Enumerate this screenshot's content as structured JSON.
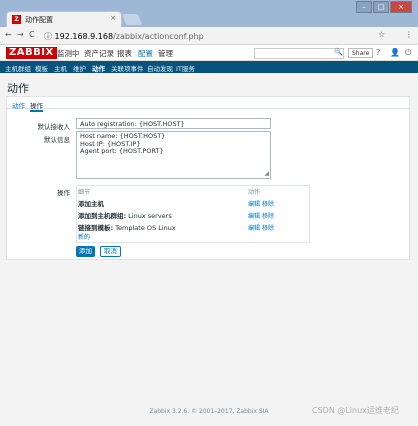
{
  "browser": {
    "tab_icon": "Z",
    "tab_title": "动作配置",
    "tab_close": "×",
    "url_host": "192.168.9.168",
    "url_path": "/zabbix/actionconf.php",
    "info_icon": "ⓘ",
    "back_icon": "←",
    "forward_icon": "→",
    "reload_icon": "C",
    "star_icon": "☆",
    "menu_icon": "⋮"
  },
  "header": {
    "logo": "ZABBIX",
    "menu": [
      "监测中",
      "资产记录",
      "报表",
      "配置",
      "管理"
    ],
    "active_menu": "配置",
    "search_icon": "🔍",
    "share": "Share",
    "help": "?",
    "user": "👤",
    "power": "⏻"
  },
  "submenu": [
    "主机群组",
    "模板",
    "主机",
    "维护",
    "动作",
    "关联项事件",
    "自动发现",
    "IT服务"
  ],
  "page": {
    "title": "动作",
    "tabs": [
      "动作",
      "操作"
    ],
    "default_subject_label": "默认接收人",
    "default_subject_value": "Auto registration: {HOST.HOST}",
    "default_message_label": "默认信息",
    "default_message_lines": [
      "Host name: {HOST.HOST}",
      "Host IP: {HOST.IP}",
      "Agent port: {HOST.PORT}"
    ],
    "operations_label": "操作",
    "table": {
      "col_details": "细节",
      "col_action": "动作",
      "rows": [
        {
          "bold": "添加主机",
          "rest": "",
          "edit": "编辑",
          "remove": "移除"
        },
        {
          "bold": "添加到主机群组:",
          "rest": " Linux servers",
          "edit": "编辑",
          "remove": "移除"
        },
        {
          "bold": "链接到模板:",
          "rest": " Template OS Linux",
          "edit": "编辑",
          "remove": "移除"
        }
      ],
      "new_link": "新的"
    },
    "add_button": "添加",
    "cancel_button": "取消"
  },
  "footer": "Zabbix 3.2.6. © 2001–2017, Zabbix SIA",
  "watermark": "CSDN @Linux运维老纪"
}
